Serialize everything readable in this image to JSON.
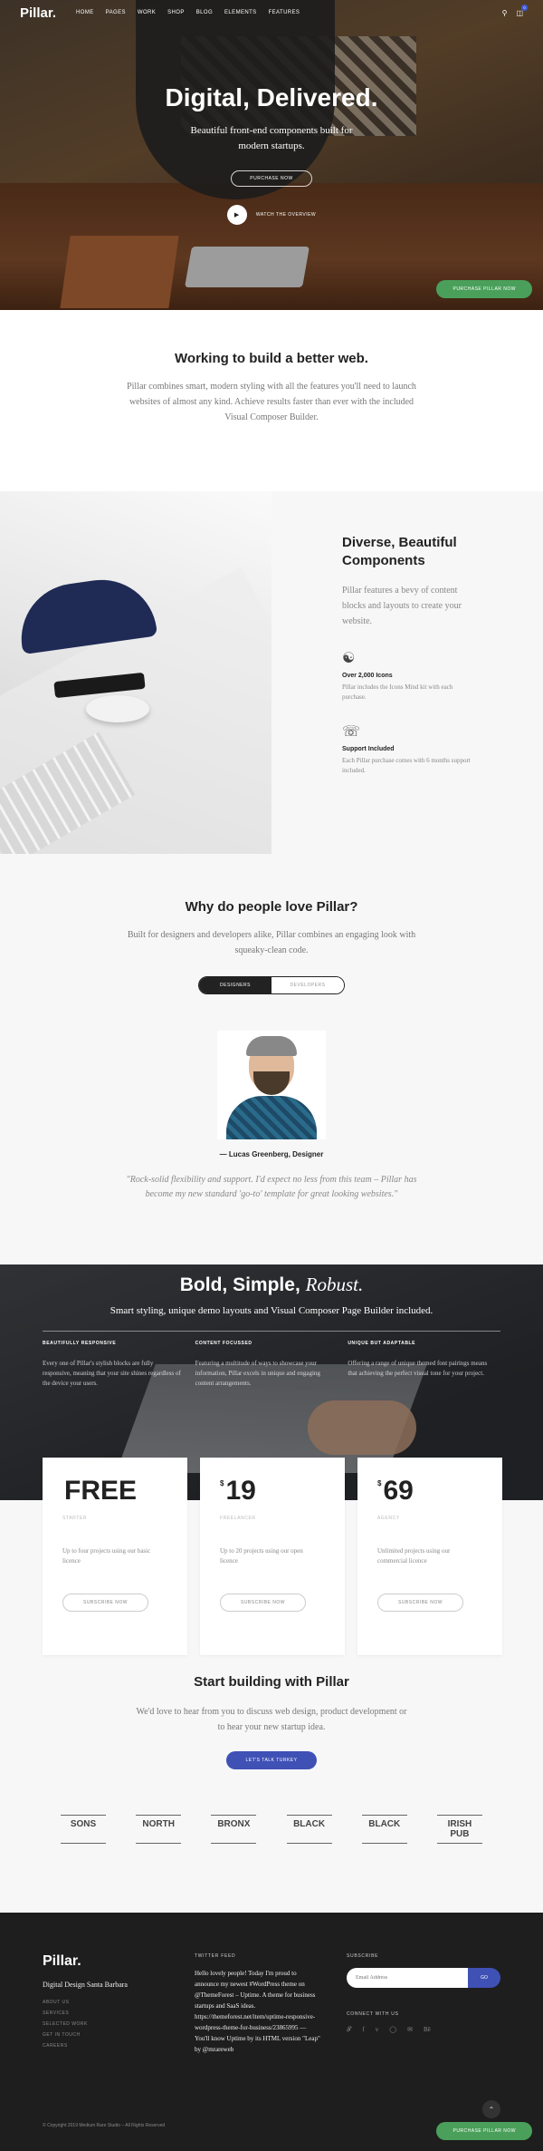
{
  "nav": {
    "logo": "Pillar.",
    "links": [
      "HOME",
      "PAGES",
      "WORK",
      "SHOP",
      "BLOG",
      "ELEMENTS",
      "FEATURES"
    ],
    "search_icon": "search-icon",
    "cart_icon": "cart-icon",
    "cart_count": "0"
  },
  "hero": {
    "title": "Digital, Delivered.",
    "subtitle": "Beautiful front-end components built for modern startups.",
    "purchase": "PURCHASE NOW",
    "video": "WATCH THE OVERVIEW",
    "sticky_cta": "PURCHASE PILLAR NOW"
  },
  "intro": {
    "title": "Working to build a better web.",
    "text": "Pillar combines smart, modern styling with all the features you'll need to launch websites of almost any kind. Achieve results faster than ever with the included Visual Composer Builder."
  },
  "features": {
    "title": "Diverse, Beautiful Components",
    "text": "Pillar features a bevy of content blocks and layouts to create your website.",
    "items": [
      {
        "icon": "mind-icon",
        "name": "Over 2,000 Icons",
        "desc": "Pillar includes the Icons Mind kit with each purchase."
      },
      {
        "icon": "headset-icon",
        "name": "Support Included",
        "desc": "Each Pillar purchase comes with 6 months support included."
      }
    ]
  },
  "love": {
    "title": "Why do people love Pillar?",
    "text": "Built for designers and developers alike, Pillar combines an engaging look with squeaky-clean code.",
    "tabs": [
      "DESIGNERS",
      "DEVELOPERS"
    ],
    "author": "— Lucas Greenberg, Designer",
    "quote": "\"Rock-solid flexibility and support. I'd expect no less from this team – Pillar has become my new standard 'go-to' template for great looking websites.\""
  },
  "pricing": {
    "title_a": "Bold, Simple,",
    "title_b": "Robust.",
    "subtitle": "Smart styling, unique demo layouts and Visual Composer Page Builder included.",
    "cols": [
      {
        "title": "BEAUTIFULLY RESPONSIVE",
        "text": "Every one of Pillar's stylish blocks are fully responsive, meaning that your site shines regardless of the device your users."
      },
      {
        "title": "CONTENT FOCUSSED",
        "text": "Featuring a multitude of ways to showcase your information, Pillar excels in unique and engaging content arrangements."
      },
      {
        "title": "UNIQUE BUT ADAPTABLE",
        "text": "Offering a range of unique themed font pairings means that achieving the perfect visual tone for your project."
      }
    ],
    "cards": [
      {
        "currency": "",
        "price": "FREE",
        "tier": "STARTER",
        "desc": "Up to four projects using our basic licence",
        "button": "SUBSCRIBE NOW"
      },
      {
        "currency": "$",
        "price": "19",
        "tier": "FREELANCER",
        "desc": "Up to 20 projects using our open licence",
        "button": "SUBSCRIBE NOW"
      },
      {
        "currency": "$",
        "price": "69",
        "tier": "AGENCY",
        "desc": "Unlimited projects using our commercial licence",
        "button": "SUBSCRIBE NOW"
      }
    ]
  },
  "cta": {
    "title": "Start building with Pillar",
    "text": "We'd love to hear from you to discuss web design, product development or to hear your new startup idea.",
    "button": "LET'S TALK TURKEY",
    "brands": [
      "SONS",
      "NORTH",
      "BRONX",
      "BLACK",
      "BLACK",
      "IRISH PUB"
    ]
  },
  "footer": {
    "logo": "Pillar.",
    "tagline": "Digital Design Santa Barbara",
    "links": [
      "ABOUT US",
      "SERVICES",
      "SELECTED WORK",
      "GET IN TOUCH",
      "CAREERS"
    ],
    "twitter_head": "TWITTER FEED",
    "tweet": "Hello lovely people! Today I'm proud to announce my newest #WordPress theme on @ThemeForest – Uptime. A theme for business startups and SaaS ideas. https://themeforest.net/item/uptime-responsive-wordpress-theme-for-business/23865995 — You'll know Uptime by its HTML version \"Leap\" by @mrareweb",
    "subscribe_head": "SUBSCRIBE",
    "email_placeholder": "Email Address",
    "go": "GO",
    "connect_head": "CONNECT WITH US",
    "social": [
      "twitter-icon",
      "facebook-icon",
      "vimeo-icon",
      "instagram-icon",
      "email-icon",
      "behance-icon"
    ],
    "copyright": "© Copyright 2019 Medium Rare Studio – All Rights Reserved",
    "sticky_cta": "PURCHASE PILLAR NOW"
  },
  "colors": {
    "accent_blue": "#3f51b5",
    "accent_green": "#4aa05a"
  }
}
